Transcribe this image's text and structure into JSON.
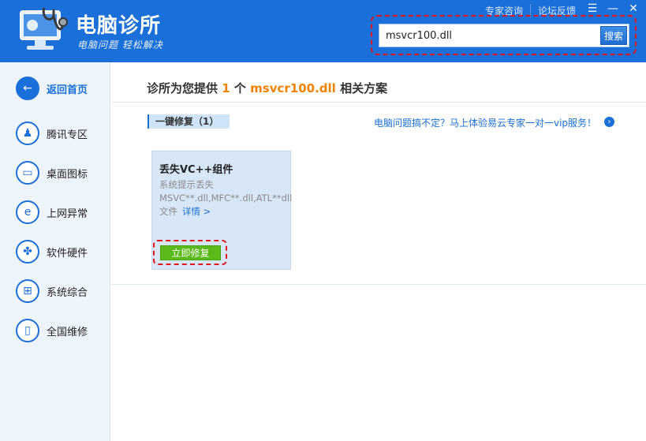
{
  "header": {
    "app_title": "电脑诊所",
    "app_subtitle": "电脑问题 轻松解决",
    "links": [
      "专家咨询",
      "论坛反馈"
    ],
    "window_controls": {
      "menu": "☰",
      "minimize": "—",
      "close": "✕"
    }
  },
  "search": {
    "value": "msvcr100.dll",
    "button_label": "搜索"
  },
  "sidebar": {
    "items": [
      {
        "label": "返回首页",
        "icon": "back-arrow-icon",
        "glyph": "←"
      },
      {
        "label": "腾讯专区",
        "icon": "qq-penguin-icon",
        "glyph": "♟"
      },
      {
        "label": "桌面图标",
        "icon": "monitor-icon",
        "glyph": "▭"
      },
      {
        "label": "上网异常",
        "icon": "ie-browser-icon",
        "glyph": "e"
      },
      {
        "label": "软件硬件",
        "icon": "software-hardware-icon",
        "glyph": "✤"
      },
      {
        "label": "系统综合",
        "icon": "windows-icon",
        "glyph": "⊞"
      },
      {
        "label": "全国维修",
        "icon": "repair-phone-icon",
        "glyph": "▯"
      }
    ]
  },
  "main": {
    "title_prefix": "诊所为您提供",
    "title_count": "1",
    "title_unit": "个",
    "title_query": "msvcr100.dll",
    "title_suffix": "相关方案",
    "section_tab": "一键修复（1）",
    "promo_text": "电脑问题搞不定？马上体验易云专家一对一vip服务！",
    "card": {
      "title": "丢失VC++组件",
      "description": "系统提示丢失MSVC**.dll,MFC**.dll,ATL**dll文件",
      "more_label": "详情 >",
      "fix_button": "立即修复"
    }
  },
  "colors": {
    "header_blue": "#1a6fd8",
    "highlight_orange": "#f08200",
    "fix_green": "#5cb91a",
    "annotation_red": "#e3161d"
  }
}
